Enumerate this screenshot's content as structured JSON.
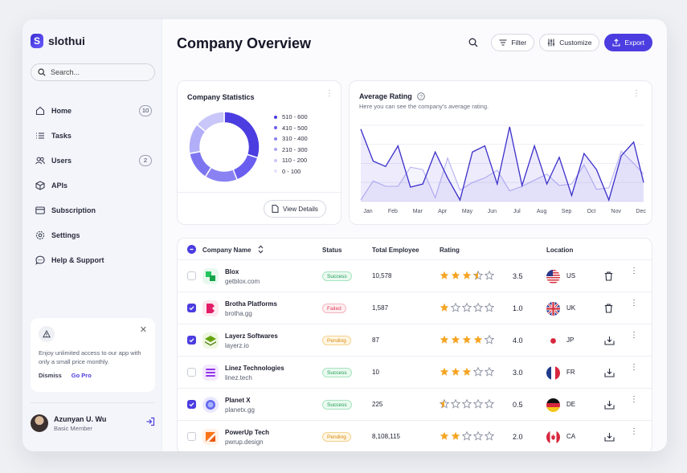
{
  "brand": {
    "name": "slothui",
    "mark": "S"
  },
  "search": {
    "placeholder": "Search..."
  },
  "sidebar": {
    "items": [
      {
        "label": "Home",
        "icon": "home-icon",
        "badge": "10"
      },
      {
        "label": "Tasks",
        "icon": "list-icon",
        "badge": ""
      },
      {
        "label": "Users",
        "icon": "users-icon",
        "badge": "2"
      },
      {
        "label": "APIs",
        "icon": "cube-icon",
        "badge": ""
      },
      {
        "label": "Subscription",
        "icon": "card-icon",
        "badge": ""
      },
      {
        "label": "Settings",
        "icon": "gear-icon",
        "badge": ""
      },
      {
        "label": "Help & Support",
        "icon": "chat-icon",
        "badge": ""
      }
    ]
  },
  "promo": {
    "text": "Enjoy unlimited access to our app with only a small price monthly.",
    "dismiss": "Dismiss",
    "gopro": "Go Pro"
  },
  "user": {
    "name": "Azunyan U. Wu",
    "role": "Basic Member"
  },
  "header": {
    "title": "Company Overview",
    "filter": "Filter",
    "customize": "Customize",
    "export": "Export"
  },
  "stats": {
    "title": "Company Statistics",
    "details": "View Details",
    "legend": [
      "510 - 600",
      "410 - 500",
      "310 - 400",
      "210 - 300",
      "110 - 200",
      "0 - 100"
    ],
    "colors": [
      "#4b3de0",
      "#6a5ef0",
      "#8a82f3",
      "#a9a4f6",
      "#c9c6f9",
      "#e4e2fc"
    ]
  },
  "rating": {
    "title": "Average Rating",
    "subtitle": "Here you can see the company's average rating."
  },
  "chart_data": {
    "type": "line",
    "categories": [
      "Jan",
      "Feb",
      "Mar",
      "Apr",
      "May",
      "Jun",
      "Jul",
      "Aug",
      "Sep",
      "Oct",
      "Nov",
      "Dec"
    ],
    "x": [
      0,
      0.5,
      1,
      1.5,
      2,
      2.5,
      3,
      3.5,
      4,
      4.5,
      5,
      5.5,
      6,
      6.5,
      7,
      7.5,
      8,
      8.5,
      9,
      9.5,
      10,
      10.5,
      11,
      11.4
    ],
    "series": [
      {
        "values": [
          9.5,
          5.3,
          4.6,
          7.3,
          1.9,
          2.3,
          6.5,
          3.1,
          0.2,
          6.5,
          7.3,
          2.3,
          9.8,
          2.1,
          7.3,
          2.3,
          5.8,
          0.8,
          6.3,
          4.2,
          0.2,
          6.0,
          7.8,
          2.5
        ]
      },
      {
        "values": [
          0.2,
          2.7,
          2.0,
          2.0,
          4.5,
          4.2,
          0.5,
          5.7,
          1.5,
          2.5,
          3.1,
          4.1,
          1.4,
          2.0,
          2.8,
          3.6,
          2.1,
          2.3,
          4.8,
          1.6,
          1.8,
          6.6,
          5.0,
          3.6
        ]
      }
    ],
    "ylim": [
      0,
      10
    ],
    "grid": true
  },
  "table": {
    "headers": {
      "company": "Company Name",
      "status": "Status",
      "employees": "Total Employee",
      "rating": "Rating",
      "location": "Location"
    },
    "rows": [
      {
        "name": "Blox",
        "domain": "getblox.com",
        "status": "Success",
        "statusClass": "success",
        "employees": "10,578",
        "rating": 3.5,
        "ratingText": "3.5",
        "country": "US",
        "flag": "us",
        "checked": false,
        "action": "trash-icon",
        "logo": "blox"
      },
      {
        "name": "Brotha Platforms",
        "domain": "brotha.gg",
        "status": "Failed",
        "statusClass": "failed",
        "employees": "1,587",
        "rating": 1.0,
        "ratingText": "1.0",
        "country": "UK",
        "flag": "uk",
        "checked": true,
        "action": "trash-icon",
        "logo": "brotha"
      },
      {
        "name": "Layerz Softwares",
        "domain": "layerz.io",
        "status": "Pending",
        "statusClass": "pending",
        "employees": "87",
        "rating": 4.0,
        "ratingText": "4.0",
        "country": "JP",
        "flag": "jp",
        "checked": true,
        "action": "download-icon",
        "logo": "layerz"
      },
      {
        "name": "Linez Technologies",
        "domain": "linez.tech",
        "status": "Success",
        "statusClass": "success",
        "employees": "10",
        "rating": 3.0,
        "ratingText": "3.0",
        "country": "FR",
        "flag": "fr",
        "checked": false,
        "action": "download-icon",
        "logo": "linez"
      },
      {
        "name": "Planet X",
        "domain": "planetx.gg",
        "status": "Success",
        "statusClass": "success",
        "employees": "225",
        "rating": 0.5,
        "ratingText": "0.5",
        "country": "DE",
        "flag": "de",
        "checked": true,
        "action": "download-icon",
        "logo": "planet"
      },
      {
        "name": "PowerUp Tech",
        "domain": "pwrup.design",
        "status": "Pending",
        "statusClass": "pending",
        "employees": "8,108,115",
        "rating": 2.0,
        "ratingText": "2.0",
        "country": "CA",
        "flag": "ca",
        "checked": false,
        "action": "download-icon",
        "logo": "powerup"
      }
    ]
  }
}
